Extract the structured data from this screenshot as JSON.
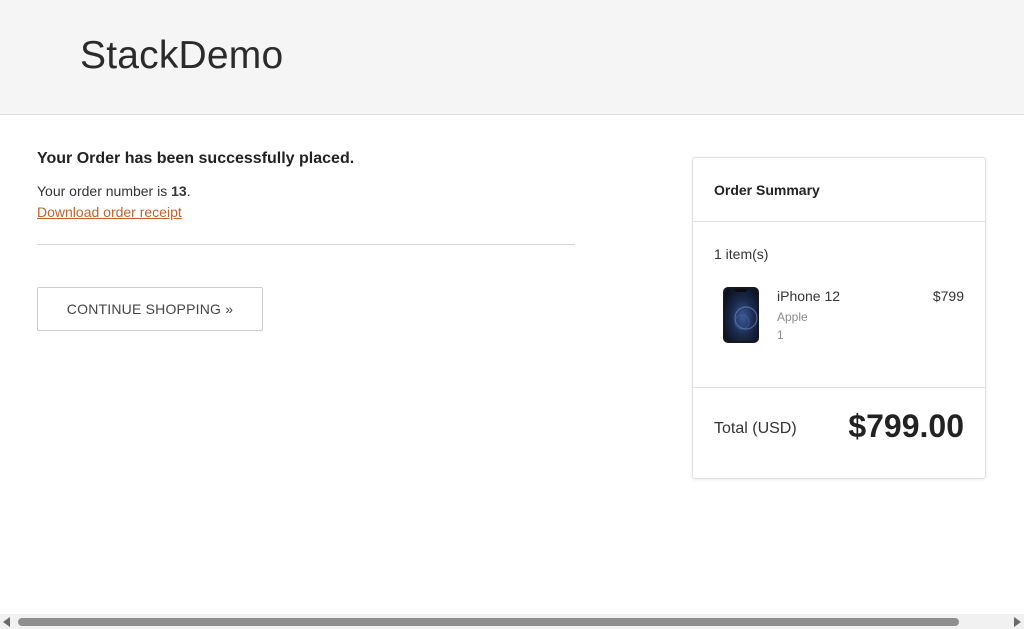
{
  "header": {
    "brand": "StackDemo"
  },
  "confirmation": {
    "title": "Your Order has been successfully placed.",
    "order_prefix": "Your order number is ",
    "order_number": "13",
    "order_suffix": ".",
    "receipt_link": "Download order receipt",
    "continue_button": "CONTINUE SHOPPING »"
  },
  "summary": {
    "title": "Order Summary",
    "item_count": "1 item(s)",
    "items": [
      {
        "name": "iPhone 12",
        "brand": "Apple",
        "quantity": "1",
        "price": "$799",
        "icon": "iphone-12-thumbnail"
      }
    ],
    "total_label": "Total (USD)",
    "total_value": "$799.00"
  },
  "colors": {
    "header_bg": "#f5f5f5",
    "link": "#c0632e",
    "text": "#333333"
  },
  "scrollbar": {
    "orientation": "horizontal",
    "left_arrow_icon": "scroll-left-arrow-icon",
    "right_arrow_icon": "scroll-right-arrow-icon"
  }
}
